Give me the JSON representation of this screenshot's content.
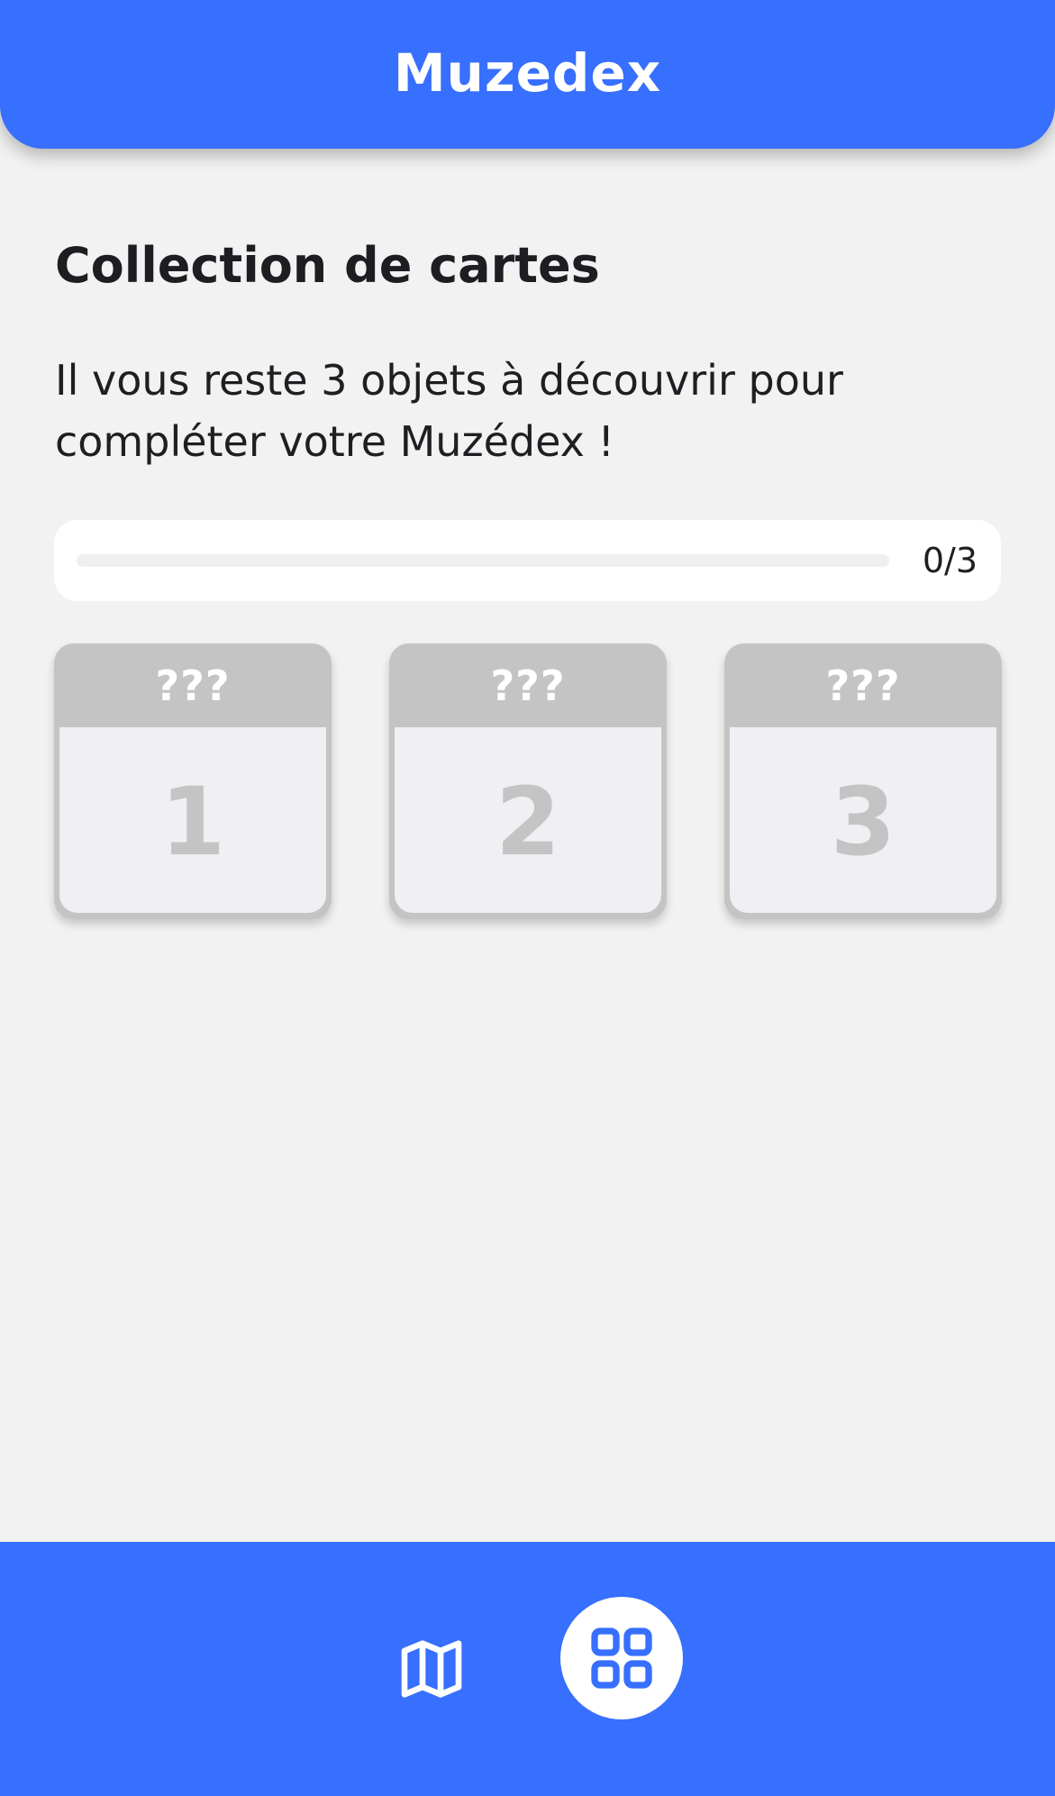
{
  "header": {
    "title": "Muzedex"
  },
  "main": {
    "title": "Collection de cartes",
    "subtitle": "Il vous reste 3 objets à découvrir pour compléter votre Muzédex !",
    "progress": {
      "label": "0/3",
      "found": 0,
      "total": 3,
      "fraction": 0
    },
    "cards": [
      {
        "name": "???",
        "number": "1"
      },
      {
        "name": "???",
        "number": "2"
      },
      {
        "name": "???",
        "number": "3"
      }
    ]
  },
  "bottom_nav": {
    "items": [
      {
        "icon": "map-icon",
        "active": false
      },
      {
        "icon": "grid-icon",
        "active": true
      }
    ]
  },
  "colors": {
    "primary": "#376ffe",
    "background": "#f2f2f2",
    "card_locked": "#c4c4c4",
    "card_body": "#efeff4"
  }
}
